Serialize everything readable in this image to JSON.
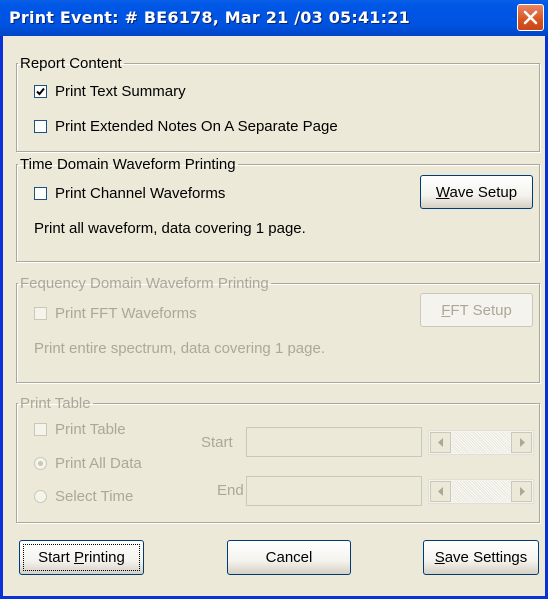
{
  "window": {
    "title": "Print Event: # BE6178, Mar 21 /03 05:41:21"
  },
  "report_content": {
    "legend": "Report Content",
    "print_text_summary": {
      "label": "Print Text Summary",
      "checked": true
    },
    "print_extended_notes": {
      "label": "Print Extended Notes On A Separate Page",
      "checked": false
    }
  },
  "time_domain": {
    "legend": "Time Domain Waveform Printing",
    "print_channel_waveforms": {
      "label": "Print Channel Waveforms",
      "checked": false
    },
    "wave_setup_pre": "",
    "wave_setup_u": "W",
    "wave_setup_post": "ave Setup",
    "summary": "Print all waveform, data covering 1 page."
  },
  "frequency_domain": {
    "legend": "Fequency Domain Waveform Printing",
    "print_fft_waveforms": {
      "label": "Print FFT Waveforms",
      "checked": false
    },
    "fft_setup_pre": "",
    "fft_setup_u": "F",
    "fft_setup_post": "FT Setup",
    "summary": "Print entire spectrum, data covering 1 page."
  },
  "print_table": {
    "legend": "Print Table",
    "print_table_check": {
      "label": "Print Table",
      "checked": false
    },
    "print_all_data": {
      "label": "Print All Data",
      "selected": true
    },
    "select_time": {
      "label": "Select Time",
      "selected": false
    },
    "start_label": "Start",
    "end_label": "End"
  },
  "buttons": {
    "start_printing_pre": "Start ",
    "start_printing_u": "P",
    "start_printing_post": "rinting",
    "cancel": "Cancel",
    "save_settings_pre": "",
    "save_settings_u": "S",
    "save_settings_post": "ave Settings"
  },
  "colors": {
    "titlebar": "#0054E3",
    "dialog_bg": "#ECE9D8",
    "disabled_text": "#ACA899",
    "close_button": "#D9531E"
  }
}
